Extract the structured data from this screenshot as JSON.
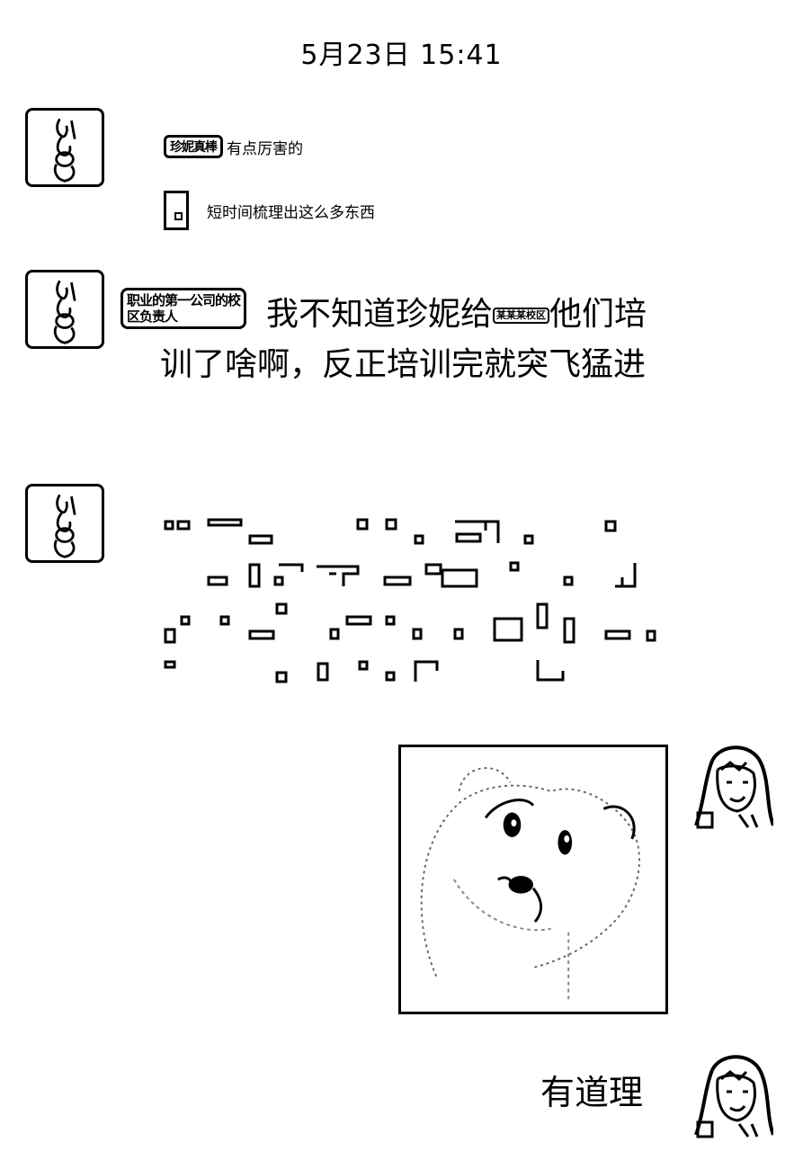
{
  "timestamp": "5月23日 15:41",
  "messages": [
    {
      "sender": "left",
      "quotes": [
        {
          "tag": "珍妮真棒",
          "text": "有点厉害的"
        },
        {
          "tag": "",
          "text": "短时间梳理出这么多东西"
        }
      ]
    },
    {
      "sender": "left",
      "name_tag": "职业的第一公司的校区负责人",
      "inline_badge": "某某某校区",
      "text_before": "我不知道珍妮给",
      "text_after": "他们培训了啥啊，反正培训完就突飞猛进"
    },
    {
      "sender": "left",
      "type": "unrendered-text"
    },
    {
      "sender": "right",
      "type": "sticker",
      "icon": "cartoon-bear-sticker"
    },
    {
      "sender": "right",
      "text": "有道理"
    }
  ]
}
